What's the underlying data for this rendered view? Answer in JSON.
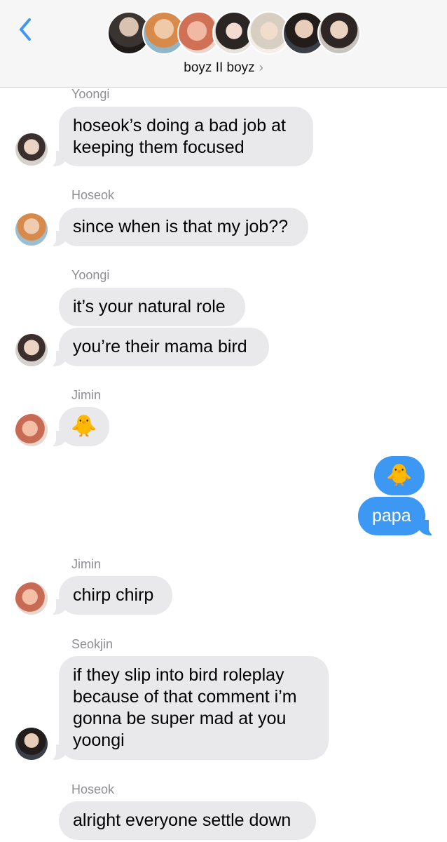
{
  "header": {
    "group_name": "boyz II boyz",
    "chevron": "›",
    "back_icon": "chevron-left-icon"
  },
  "colors": {
    "accent": "#3d98f3",
    "incoming_bubble": "#e9e9eb",
    "sender_label": "#8e8e93"
  },
  "messages": {
    "m1": {
      "sender": "Yoongi",
      "text": "hoseok’s doing a bad job at keeping them focused"
    },
    "m2": {
      "sender": "Hoseok",
      "text": "since when is that my job??"
    },
    "m3": {
      "sender": "Yoongi",
      "text": "it’s your natural role"
    },
    "m4": {
      "text": "you’re their mama bird"
    },
    "m5": {
      "sender": "Jimin",
      "text": "🐥"
    },
    "m6": {
      "text": "🐥"
    },
    "m7": {
      "text": "papa"
    },
    "m8": {
      "sender": "Jimin",
      "text": "chirp chirp"
    },
    "m9": {
      "sender": "Seokjin",
      "text": "if they slip into bird roleplay because of that comment i’m gonna be super mad at you yoongi"
    },
    "m10": {
      "sender": "Hoseok",
      "text": "alright everyone settle down"
    }
  }
}
